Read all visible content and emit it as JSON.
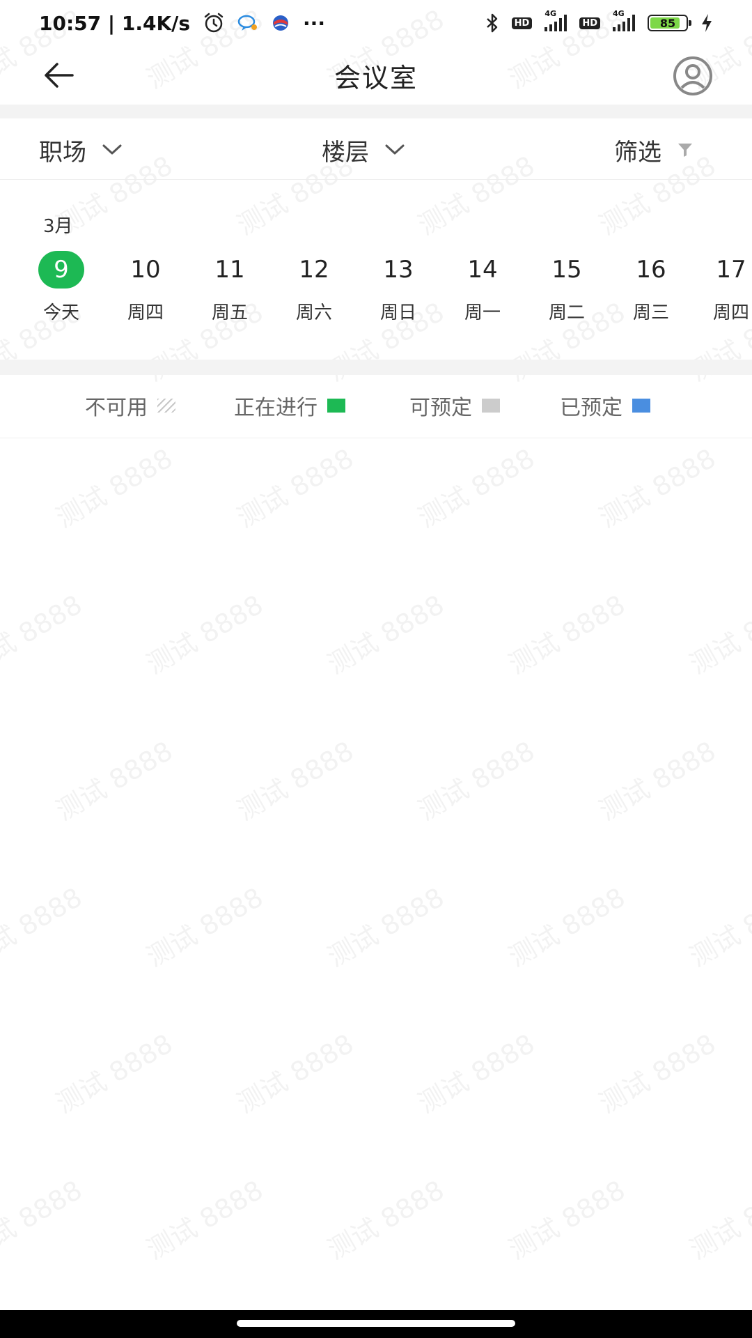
{
  "status_bar": {
    "time_speed": "10:57 | 1.4K/s",
    "more": "···",
    "hd1": "HD",
    "hd2": "HD",
    "net1": "4G",
    "net2": "4G",
    "battery_level": "85",
    "battery_fill_fraction": 0.85,
    "battery_color": "#7dd848"
  },
  "header": {
    "title": "会议室"
  },
  "filters": {
    "workplace": "职场",
    "floor": "楼层",
    "filter": "筛选"
  },
  "calendar": {
    "month": "3月",
    "days": [
      {
        "num": "9",
        "label": "今天",
        "selected": true
      },
      {
        "num": "10",
        "label": "周四"
      },
      {
        "num": "11",
        "label": "周五"
      },
      {
        "num": "12",
        "label": "周六"
      },
      {
        "num": "13",
        "label": "周日"
      },
      {
        "num": "14",
        "label": "周一"
      },
      {
        "num": "15",
        "label": "周二"
      },
      {
        "num": "16",
        "label": "周三"
      },
      {
        "num": "17",
        "label": "周四"
      }
    ],
    "selected_color": "#1db954"
  },
  "legend": {
    "unavailable": "不可用",
    "in_progress": "正在进行",
    "available": "可预定",
    "booked": "已预定",
    "colors": {
      "in_progress": "#1db954",
      "available": "#cccccc",
      "booked": "#4a8ee0"
    }
  },
  "watermark": {
    "text": "测试 8888"
  }
}
